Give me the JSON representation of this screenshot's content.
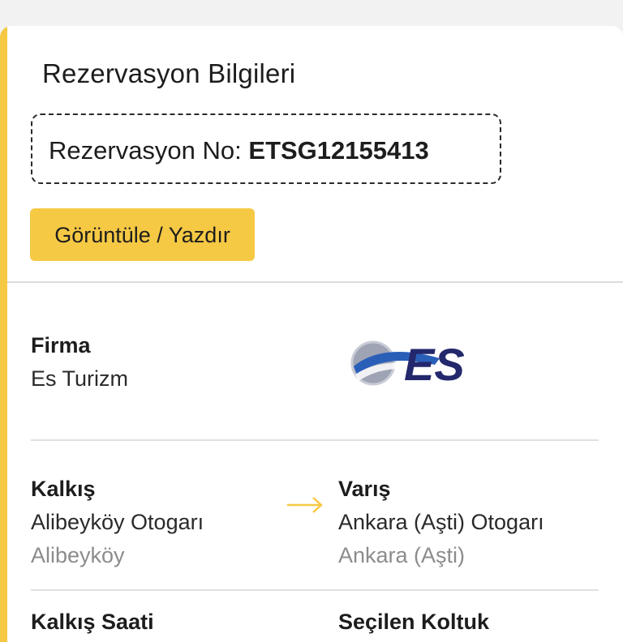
{
  "section": {
    "title": "Rezervasyon Bilgileri"
  },
  "reservation": {
    "label": "Rezervasyon No: ",
    "number": "ETSG12155413"
  },
  "actions": {
    "view_print_label": "Görüntüle / Yazdır"
  },
  "company": {
    "label": "Firma",
    "name": "Es Turizm",
    "logo_text": "ES"
  },
  "route": {
    "departure_label": "Kalkış",
    "departure_station": "Alibeyköy Otogarı",
    "departure_city": "Alibeyköy",
    "arrival_label": "Varış",
    "arrival_station": "Ankara (Aşti) Otogarı",
    "arrival_city": "Ankara (Aşti)"
  },
  "details": {
    "departure_time_label": "Kalkış Saati",
    "selected_seat_label": "Seçilen Koltuk"
  },
  "colors": {
    "accent": "#f6c945",
    "logo_blue": "#23276b",
    "muted_text": "#8c8c8c"
  },
  "icons": {
    "route_arrow": "arrow-right-icon"
  }
}
